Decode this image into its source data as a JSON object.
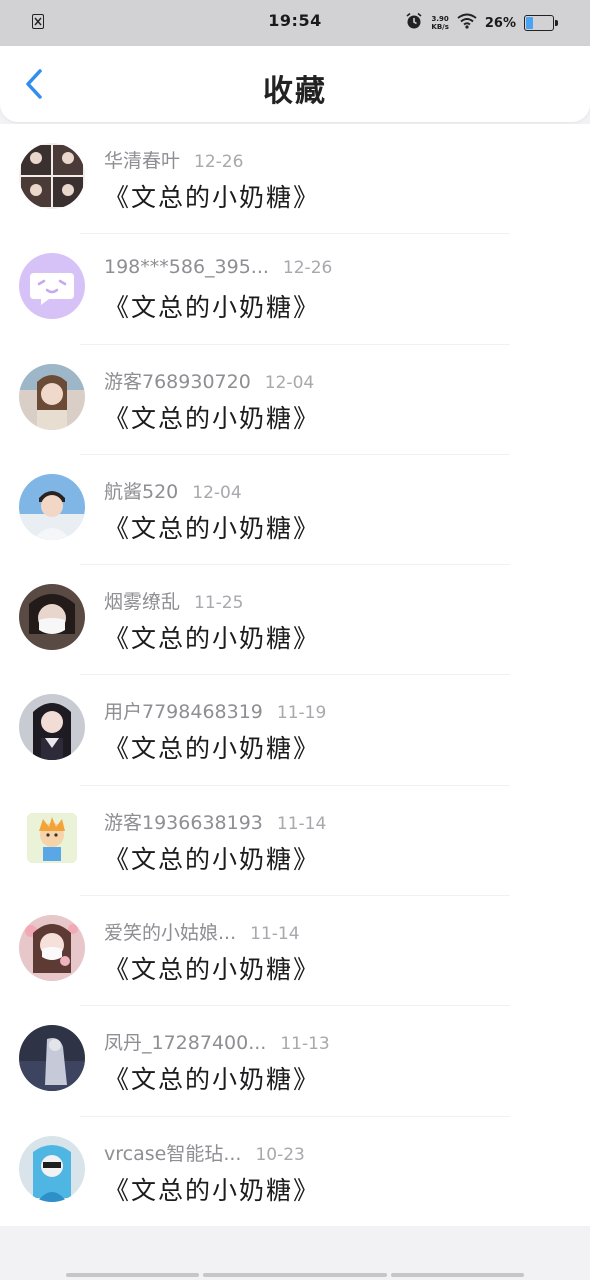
{
  "status_bar": {
    "time": "19:54",
    "net_speed_value": "3.90",
    "net_speed_unit": "KB/s",
    "battery_percent": "26%",
    "battery_level": 0.26
  },
  "header": {
    "title": "收藏"
  },
  "favorites": [
    {
      "user": "华清春叶",
      "date": "12-26",
      "title": "《文总的小奶糖》",
      "avatar": "photo-grid"
    },
    {
      "user": "198***586_395...",
      "date": "12-26",
      "title": "《文总的小奶糖》",
      "avatar": "default-chat"
    },
    {
      "user": "游客768930720",
      "date": "12-04",
      "title": "《文总的小奶糖》",
      "avatar": "photo-girl"
    },
    {
      "user": "航酱520",
      "date": "12-04",
      "title": "《文总的小奶糖》",
      "avatar": "photo-boy"
    },
    {
      "user": "烟雾缭乱",
      "date": "11-25",
      "title": "《文总的小奶糖》",
      "avatar": "photo-mask"
    },
    {
      "user": "用户7798468319",
      "date": "11-19",
      "title": "《文总的小奶糖》",
      "avatar": "photo-girl-dark"
    },
    {
      "user": "游客1936638193",
      "date": "11-14",
      "title": "《文总的小奶糖》",
      "avatar": "cartoon"
    },
    {
      "user": "爱笑的小姑娘...",
      "date": "11-14",
      "title": "《文总的小奶糖》",
      "avatar": "photo-flowers"
    },
    {
      "user": "凤丹_17287400...",
      "date": "11-13",
      "title": "《文总的小奶糖》",
      "avatar": "photo-night"
    },
    {
      "user": "vrcase智能玷...",
      "date": "10-23",
      "title": "《文总的小奶糖》",
      "avatar": "photo-blue"
    }
  ],
  "colors": {
    "accent": "#2f8df0",
    "avatar_default": "#d7c2f7"
  }
}
